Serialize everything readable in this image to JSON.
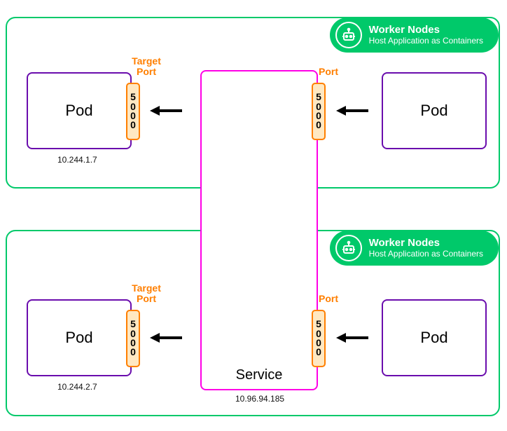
{
  "nodes": {
    "top": {
      "badge_title": "Worker Nodes",
      "badge_sub": "Host Application as Containers",
      "pod_left_label": "Pod",
      "pod_left_ip": "10.244.1.7",
      "pod_right_label": "Pod",
      "target_port_title": "Target\nPort",
      "target_port_value": "5000",
      "port_title": "Port",
      "port_value": "5000"
    },
    "bottom": {
      "badge_title": "Worker Nodes",
      "badge_sub": "Host Application as Containers",
      "pod_left_label": "Pod",
      "pod_left_ip": "10.244.2.7",
      "pod_right_label": "Pod",
      "target_port_title": "Target\nPort",
      "target_port_value": "5000",
      "port_title": "Port",
      "port_value": "5000"
    }
  },
  "service": {
    "label": "Service",
    "ip": "10.96.94.185"
  },
  "colors": {
    "green": "#00c96a",
    "purple": "#6a0dad",
    "orange": "#ff7f00",
    "magenta": "#ff00e6"
  }
}
